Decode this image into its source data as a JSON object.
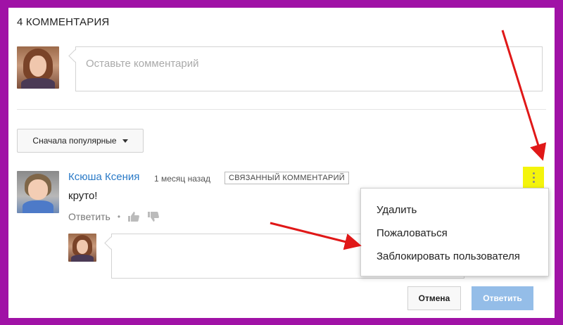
{
  "header": {
    "title": "4 КОММЕНТАРИЯ"
  },
  "new_comment": {
    "placeholder": "Оставьте комментарий"
  },
  "sort": {
    "label": "Сначала популярные"
  },
  "comment": {
    "author": "Ксюша Ксения",
    "time": "1 месяц назад",
    "badge": "СВЯЗАННЫЙ КОММЕНТАРИЙ",
    "text": "круто!",
    "reply_label": "Ответить",
    "separator": "•"
  },
  "reply": {
    "cancel_label": "Отмена",
    "submit_label": "Ответить"
  },
  "menu": {
    "items": [
      {
        "label": "Удалить"
      },
      {
        "label": "Пожаловаться"
      },
      {
        "label": "Заблокировать пользователя"
      }
    ]
  },
  "colors": {
    "frame": "#a012a6",
    "link": "#2a7ac7",
    "highlight": "#f4f40c",
    "arrow": "#e01818",
    "submit_disabled": "#94bde8"
  },
  "icons": [
    "user-avatar-icon",
    "thumb-up-icon",
    "thumb-down-icon",
    "more-vert-icon",
    "chevron-down-icon"
  ]
}
